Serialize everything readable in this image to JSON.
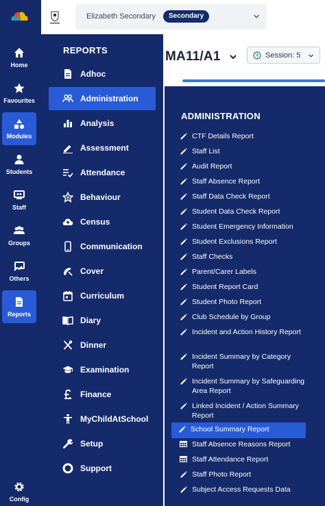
{
  "rail": {
    "items": [
      {
        "label": "Home",
        "icon": "home-icon"
      },
      {
        "label": "Favourites",
        "icon": "star-icon"
      },
      {
        "label": "Modules",
        "icon": "shapes-icon",
        "active": true
      },
      {
        "label": "Students",
        "icon": "person-icon"
      },
      {
        "label": "Staff",
        "icon": "staff-icon"
      },
      {
        "label": "Groups",
        "icon": "groups-icon"
      },
      {
        "label": "Others",
        "icon": "others-icon"
      },
      {
        "label": "Reports",
        "icon": "report-icon",
        "active": true
      }
    ],
    "config_label": "Config"
  },
  "topbar": {
    "school_name": "Elizabeth Secondary",
    "school_badge": "Secondary"
  },
  "header": {
    "class_title": "MA11/A1",
    "session_label": "Session: 5"
  },
  "reports": {
    "title": "REPORTS",
    "items": [
      {
        "label": "Adhoc",
        "icon": "document-icon"
      },
      {
        "label": "Administration",
        "icon": "people-icon",
        "active": true
      },
      {
        "label": "Analysis",
        "icon": "bar-chart-icon"
      },
      {
        "label": "Assessment",
        "icon": "pen-icon"
      },
      {
        "label": "Attendance",
        "icon": "checklist-icon"
      },
      {
        "label": "Behaviour",
        "icon": "star-outline-icon"
      },
      {
        "label": "Census",
        "icon": "cloud-upload-icon"
      },
      {
        "label": "Communication",
        "icon": "phone-icon"
      },
      {
        "label": "Cover",
        "icon": "cover-icon"
      },
      {
        "label": "Curriculum",
        "icon": "calendar-icon"
      },
      {
        "label": "Diary",
        "icon": "book-icon"
      },
      {
        "label": "Dinner",
        "icon": "cutlery-icon"
      },
      {
        "label": "Examination",
        "icon": "graduation-cap-icon"
      },
      {
        "label": "Finance",
        "icon": "pound-icon"
      },
      {
        "label": "MyChildAtSchool",
        "icon": "child-icon"
      },
      {
        "label": "Setup",
        "icon": "wrench-icon"
      },
      {
        "label": "Support",
        "icon": "support-icon"
      }
    ]
  },
  "administration": {
    "title": "ADMINISTRATION",
    "items": [
      {
        "label": "CTF Details Report",
        "icon": "pencil-icon"
      },
      {
        "label": "Staff List",
        "icon": "pencil-icon"
      },
      {
        "label": "Audit Report",
        "icon": "pencil-icon"
      },
      {
        "label": "Staff Absence Report",
        "icon": "pencil-icon"
      },
      {
        "label": "Staff Data Check Report",
        "icon": "pencil-icon"
      },
      {
        "label": "Student Data Check Report",
        "icon": "pencil-icon"
      },
      {
        "label": "Student Emergency Information",
        "icon": "pencil-icon"
      },
      {
        "label": "Student Exclusions Report",
        "icon": "pencil-icon"
      },
      {
        "label": "Staff Checks",
        "icon": "pencil-icon"
      },
      {
        "label": "Parent/Carer Labels",
        "icon": "pencil-icon"
      },
      {
        "label": "Student Report Card",
        "icon": "pencil-icon"
      },
      {
        "label": "Student Photo Report",
        "icon": "pencil-icon"
      },
      {
        "label": "Club Schedule by Group",
        "icon": "pencil-icon"
      },
      {
        "label": "Incident and Action History Report",
        "icon": "pencil-icon"
      },
      {
        "label": "Incident Summary by Category Report",
        "icon": "pencil-icon"
      },
      {
        "label": "Incident Summary by Safeguarding Area Report",
        "icon": "pencil-icon"
      },
      {
        "label": "Linked Incident / Action Summary Report",
        "icon": "pencil-icon"
      },
      {
        "label": "School Summary Report",
        "icon": "pencil-icon",
        "active": true
      },
      {
        "label": "Staff Absence Reasons Report",
        "icon": "table-icon"
      },
      {
        "label": "Staff Attendance Report",
        "icon": "table-icon"
      },
      {
        "label": "Staff Photo Report",
        "icon": "pencil-icon"
      },
      {
        "label": "Subject Access Requests Data",
        "icon": "pencil-icon"
      }
    ]
  },
  "colors": {
    "navy": "#142a6b",
    "active_blue": "#2a5bd7",
    "accent": "#3a7bd5"
  }
}
